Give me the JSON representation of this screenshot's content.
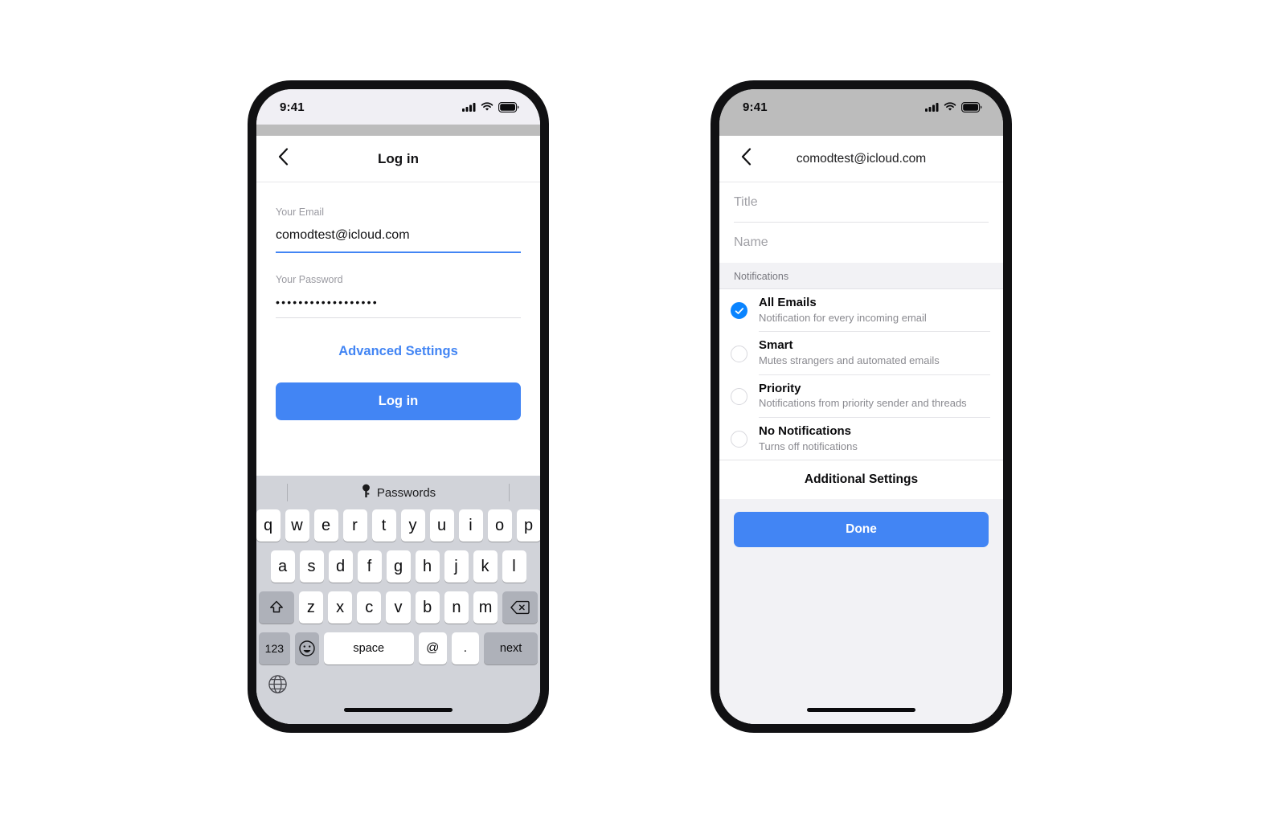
{
  "colors": {
    "accent_blue": "#4285f4",
    "radio_blue": "#0a84ff",
    "keyboard_bg": "#d1d3d9",
    "screen_bg": "#f2f2f5",
    "status_left": "#f0eff4",
    "status_right": "#bcbcbc"
  },
  "left_phone": {
    "status": {
      "time": "9:41",
      "cellular_icon": "signal-bars-icon",
      "wifi_icon": "wifi-icon",
      "battery_icon": "battery-icon"
    },
    "nav": {
      "back_icon": "chevron-left-icon",
      "title": "Log in"
    },
    "form": {
      "email": {
        "label": "Your Email",
        "value": "comodtest@icloud.com",
        "placeholder": "Your Email"
      },
      "password": {
        "label": "Your Password",
        "value": "••••••••••••••••••",
        "placeholder": "Your Password"
      },
      "advanced_settings_label": "Advanced Settings",
      "login_button_label": "Log in"
    },
    "keyboard": {
      "suggestion_icon": "key-icon",
      "suggestion_label": "Passwords",
      "row1": [
        "q",
        "w",
        "e",
        "r",
        "t",
        "y",
        "u",
        "i",
        "o",
        "p"
      ],
      "row2": [
        "a",
        "s",
        "d",
        "f",
        "g",
        "h",
        "j",
        "k",
        "l"
      ],
      "row3": [
        "z",
        "x",
        "c",
        "v",
        "b",
        "n",
        "m"
      ],
      "shift_icon": "shift-icon",
      "backspace_icon": "backspace-icon",
      "numbers_label": "123",
      "emoji_icon": "emoji-icon",
      "space_label": "space",
      "at_label": "@",
      "dot_label": ".",
      "next_label": "next",
      "globe_icon": "globe-icon"
    }
  },
  "right_phone": {
    "status": {
      "time": "9:41",
      "cellular_icon": "signal-bars-icon",
      "wifi_icon": "wifi-icon",
      "battery_icon": "battery-icon"
    },
    "nav": {
      "back_icon": "chevron-left-icon",
      "title": "comodtest@icloud.com"
    },
    "fields": [
      {
        "placeholder": "Title",
        "value": ""
      },
      {
        "placeholder": "Name",
        "value": ""
      }
    ],
    "section_header": "Notifications",
    "options": [
      {
        "title": "All Emails",
        "subtitle": "Notification for every incoming email",
        "selected": true
      },
      {
        "title": "Smart",
        "subtitle": "Mutes strangers and automated emails",
        "selected": false
      },
      {
        "title": "Priority",
        "subtitle": "Notifications from priority sender and threads",
        "selected": false
      },
      {
        "title": "No Notifications",
        "subtitle": "Turns off notifications",
        "selected": false
      }
    ],
    "additional_settings_label": "Additional Settings",
    "done_button_label": "Done"
  }
}
